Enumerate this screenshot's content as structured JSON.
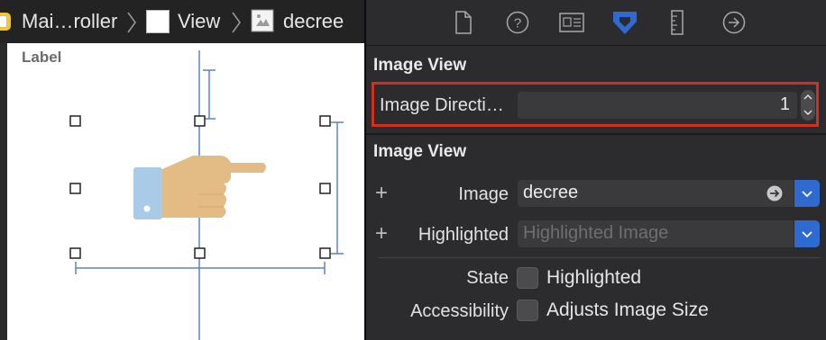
{
  "breadcrumb": {
    "items": [
      {
        "label": "Mai…roller",
        "icon": "storyboard-scene-icon"
      },
      {
        "label": "View",
        "icon": "view-icon"
      },
      {
        "label": "decree",
        "icon": "image-view-icon"
      }
    ]
  },
  "canvas": {
    "label_text": "Label"
  },
  "inspector": {
    "toolbar": [
      {
        "name": "file-inspector-icon"
      },
      {
        "name": "quick-help-icon"
      },
      {
        "name": "identity-inspector-icon"
      },
      {
        "name": "attributes-inspector-icon",
        "active": true
      },
      {
        "name": "size-inspector-icon"
      },
      {
        "name": "connections-inspector-icon"
      }
    ],
    "section1_title": "Image View",
    "image_direction": {
      "label": "Image Directi…",
      "value": "1"
    },
    "section2_title": "Image View",
    "image": {
      "label": "Image",
      "value": "decree"
    },
    "highlighted": {
      "label": "Highlighted",
      "placeholder": "Highlighted Image"
    },
    "state": {
      "label": "State",
      "checkbox_label": "Highlighted"
    },
    "accessibility": {
      "label": "Accessibility",
      "checkbox_label": "Adjusts Image Size"
    },
    "plus_symbol": "+"
  },
  "colors": {
    "accent": "#2f6ad1",
    "highlight_border": "#d0311e",
    "constraint_line": "#5b84c4"
  }
}
